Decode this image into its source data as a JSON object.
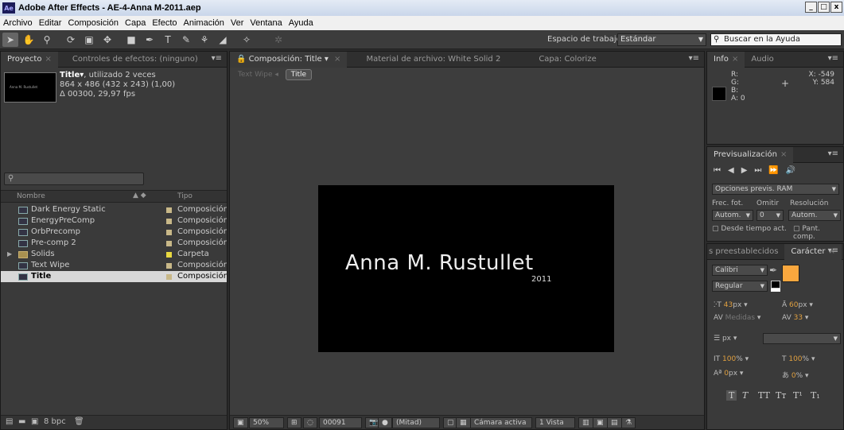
{
  "window": {
    "title": "Adobe After Effects - AE-4-Anna M-2011.aep",
    "logo": "Ae",
    "buttons": [
      "_",
      "□",
      "x"
    ]
  },
  "menu": [
    "Archivo",
    "Editar",
    "Composición",
    "Capa",
    "Efecto",
    "Animación",
    "Ver",
    "Ventana",
    "Ayuda"
  ],
  "toolbar": {
    "workspace_label": "Espacio de trabajo:",
    "workspace_value": "Estándar",
    "help_placeholder": "Buscar en la Ayuda"
  },
  "project": {
    "tabs": [
      "Proyecto",
      "Controles de efectos: (ninguno)"
    ],
    "thumb_text": "Anna M. Rustullet",
    "item_name": "Title▾",
    "item_usage": ", utilizado 2 veces",
    "item_size": "864 x 486  (432 x 243) (1,00)",
    "item_duration": "Δ 00300, 29,97 fps",
    "columns": [
      "Nombre",
      "Tipo"
    ],
    "items": [
      {
        "name": "Dark Energy Static",
        "type": "Composición",
        "kind": "comp",
        "label": "#c8b888"
      },
      {
        "name": "EnergyPreComp",
        "type": "Composición",
        "kind": "comp",
        "label": "#c8b888"
      },
      {
        "name": "OrbPrecomp",
        "type": "Composición",
        "kind": "comp",
        "label": "#c8b888"
      },
      {
        "name": "Pre-comp 2",
        "type": "Composición",
        "kind": "comp",
        "label": "#c8b888"
      },
      {
        "name": "Solids",
        "type": "Carpeta",
        "kind": "folder",
        "label": "#e8d840"
      },
      {
        "name": "Text Wipe",
        "type": "Composición",
        "kind": "comp",
        "label": "#c8b888"
      },
      {
        "name": "Title",
        "type": "Composición",
        "kind": "comp",
        "label": "#c8b888",
        "selected": true
      }
    ],
    "bpc": "8 bpc"
  },
  "composition": {
    "tabs": [
      "Composición: Title",
      "Material de archivo: White Solid 2",
      "Capa: Colorize"
    ],
    "breadcrumb_prev": "Text Wipe",
    "breadcrumb_current": "Title",
    "title_text": "Anna M. Rustullet",
    "year_text": "2011",
    "zoom": "50%",
    "timecode": "00091",
    "resolution": "(Mitad)",
    "camera": "Cámara activa",
    "views": "1 Vista"
  },
  "info": {
    "tabs": [
      "Info",
      "Audio"
    ],
    "r_label": "R:",
    "g_label": "G:",
    "b_label": "B:",
    "a_label": "A:",
    "a_value": "0",
    "x_label": "X:",
    "x_value": "-549",
    "y_label": "Y:",
    "y_value": "584"
  },
  "preview": {
    "tab": "Previsualización",
    "ram_options": "Opciones previs. RAM",
    "frame_rate": "Frec. fot.",
    "skip": "Omitir",
    "resolution": "Resolución",
    "frame_value": "Autom.",
    "skip_value": "0",
    "res_value": "Autom.",
    "from_current": "Desde tiempo act.",
    "full_screen": "Pant. comp."
  },
  "character": {
    "tabs": [
      "s preestablecidos",
      "Carácter"
    ],
    "font": "Calibri",
    "style": "Regular",
    "size": "43",
    "size_unit": "px",
    "leading": "60",
    "leading_unit": "px",
    "kerning": "Medidas",
    "tracking": "33",
    "stroke_unit": "px",
    "vscale": "100",
    "hscale": "100",
    "baseline": "0",
    "baseline_unit": "px",
    "tsume": "0",
    "fill_color": "#f9a73e"
  }
}
